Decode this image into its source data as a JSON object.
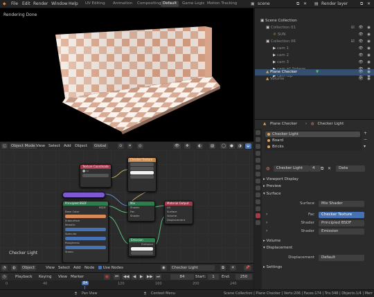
{
  "topbar": {
    "menus": [
      "File",
      "Edit",
      "Render",
      "Window",
      "Help"
    ],
    "workspaces": [
      "UV Editing",
      "Animation",
      "Compositing",
      "Default",
      "Game Logic",
      "Motion Tracking"
    ],
    "active_workspace": "Default",
    "scene_name": "scene",
    "render_layer": "Render layer"
  },
  "viewport": {
    "status_text": "Rendering Done",
    "mode": "Object Mode",
    "menus": [
      "View",
      "Select",
      "Add",
      "Object"
    ],
    "orientation": "Global"
  },
  "node_editor": {
    "label": "Checker Light",
    "header_menus": [
      "View",
      "Select",
      "Add",
      "Node"
    ],
    "object_type": "Object",
    "use_nodes_label": "Use Nodes",
    "material_name": "Checker Light",
    "nodes": {
      "texcoord": "Texture Coordinate",
      "checker": "Checker Texture",
      "mapping": "Mapping",
      "emission_green": "Mix",
      "output": "Material Output",
      "emission": "Emission",
      "principled": "Principled BSDF",
      "principled_rows": [
        "BSDF",
        "Base Color",
        "Subsurface",
        "Metallic",
        "Specular",
        "Roughness",
        "Sheen",
        "Clearcoat",
        "IOR",
        "Transmission",
        "Emission",
        "Alpha"
      ]
    }
  },
  "timeline": {
    "menus": [
      "Playback",
      "Keying",
      "View",
      "Marker"
    ],
    "current_frame": "84",
    "start_label": "Start:",
    "start": "1",
    "end_label": "End:",
    "end": "250",
    "marks": [
      "0",
      "40",
      "80",
      "120",
      "160",
      "200",
      "240"
    ]
  },
  "statusbar": {
    "left_hint": "Pan View",
    "middle_hint": "Context Menu",
    "stats": "Scene Collection | Plane Checker | Verts:206 | Faces:174 | Tris:348 | Objects:1/4 | Mem: 74.1"
  },
  "outliner": {
    "rows": [
      {
        "label": "Scene Collection",
        "indent": 0,
        "selected": false
      },
      {
        "label": "Collection 01",
        "indent": 1,
        "selected": false
      },
      {
        "label": "SUN",
        "indent": 2,
        "selected": false
      },
      {
        "label": "Collection 06",
        "indent": 1,
        "selected": false
      },
      {
        "label": "cam 1",
        "indent": 2,
        "selected": false
      },
      {
        "label": "cam 2",
        "indent": 2,
        "selected": false
      },
      {
        "label": "cam 3",
        "indent": 2,
        "selected": false
      },
      {
        "label": "cam all Sphere",
        "indent": 2,
        "selected": false
      },
      {
        "label": "cam top",
        "indent": 2,
        "selected": false
      },
      {
        "label": "Plane Checker",
        "indent": 1,
        "selected": true
      },
      {
        "label": "Volume",
        "indent": 1,
        "selected": false
      }
    ]
  },
  "properties": {
    "object_name": "Plane Checker",
    "material_label": "Checker Light",
    "material_slots": [
      "Checker Light",
      "Board",
      "Bricks"
    ],
    "material_field": "Checker Light",
    "users": "4",
    "data_mode": "Data",
    "sections": {
      "viewport_display": "Viewport Display",
      "preview": "Preview",
      "surface": "Surface",
      "volume": "Volume",
      "displacement": "Displacement",
      "settings": "Settings"
    },
    "surface_rows": [
      {
        "label": "Surface",
        "value": "Mix Shader"
      },
      {
        "label": "Fac",
        "value": "Checker Texture"
      },
      {
        "label": "Shader",
        "value": "Principled BSDF"
      },
      {
        "label": "Shader",
        "value": "Emission"
      }
    ],
    "displacement_row": {
      "label": "Displacement",
      "value": "Default"
    }
  },
  "colors": {
    "accent_blue": "#4772b3",
    "selection_row": "#34506e",
    "node_green": "#2e7d4f",
    "node_red": "#a33a4a",
    "node_orange": "#c88a4a",
    "node_purple": "#7c5bd0"
  }
}
